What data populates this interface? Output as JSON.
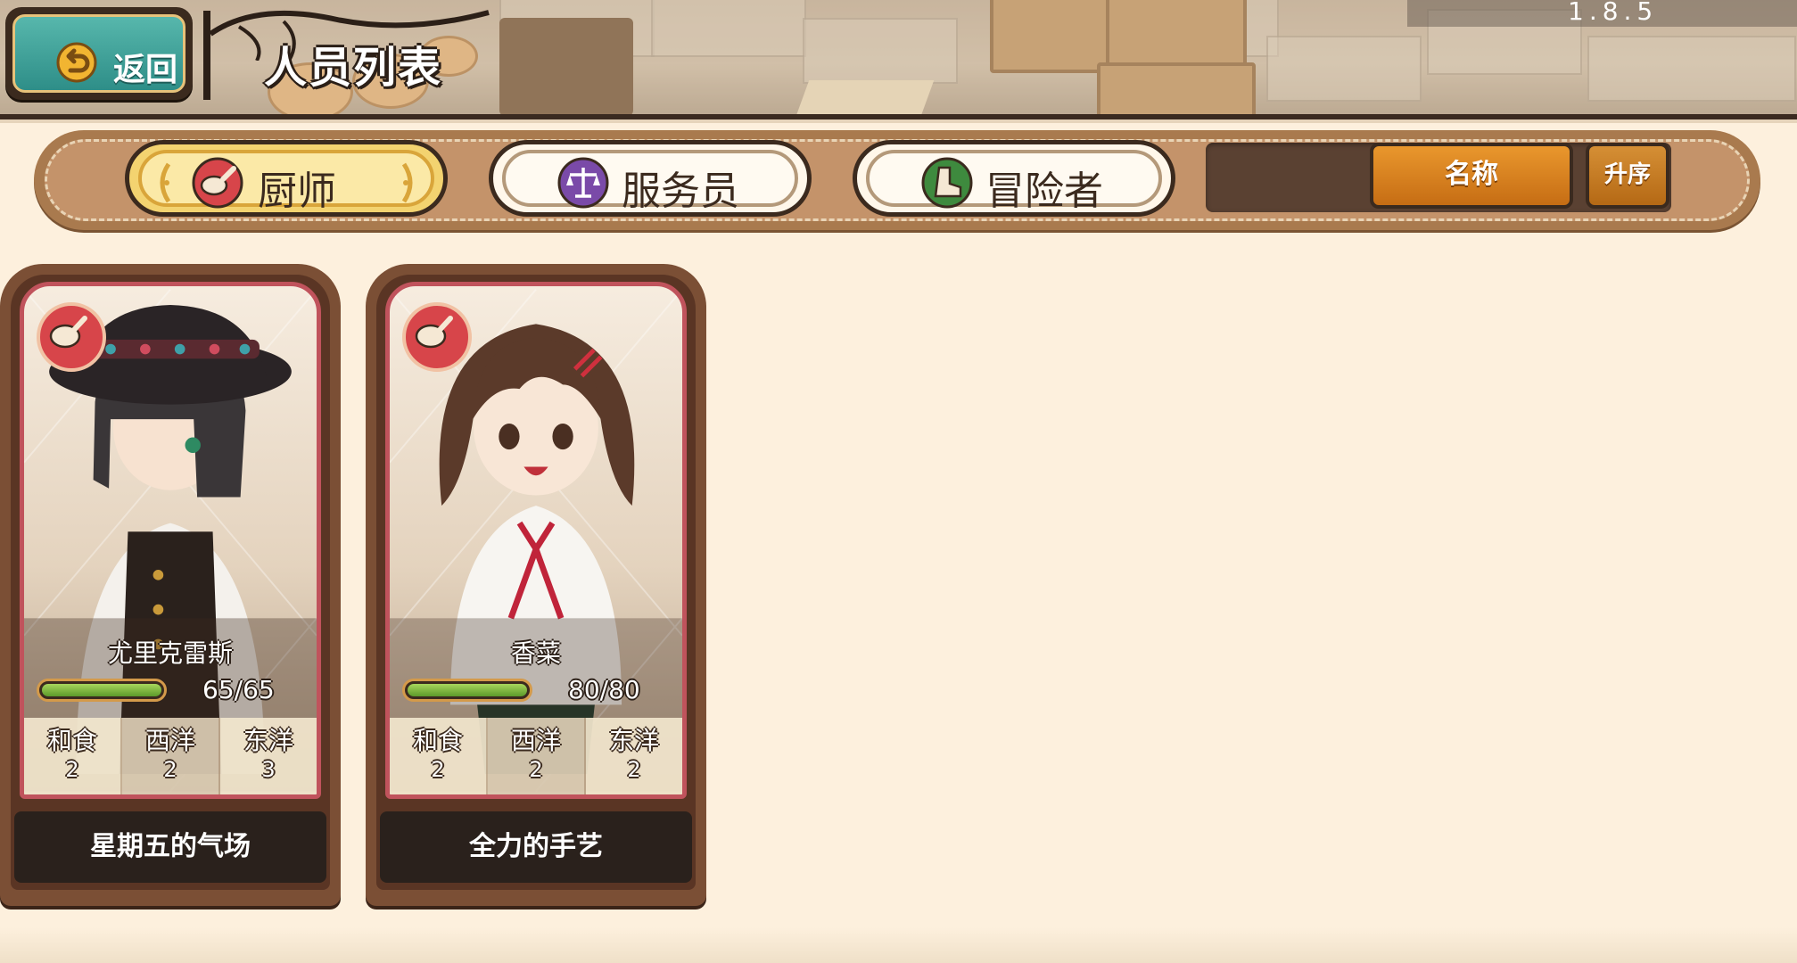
{
  "version": "1.8.5",
  "header": {
    "back_label": "返回",
    "title": "人员列表"
  },
  "tabs": [
    {
      "label": "厨师",
      "icon": "frying-pan-icon",
      "selected": true
    },
    {
      "label": "服务员",
      "icon": "scales-icon",
      "selected": false
    },
    {
      "label": "冒险者",
      "icon": "boot-icon",
      "selected": false
    }
  ],
  "sort": {
    "field_label": "名称",
    "order_label": "升序"
  },
  "stat_labels": [
    "和食",
    "西洋",
    "东洋"
  ],
  "cards": [
    {
      "name": "尤里克雷斯",
      "hp_text": "65/65",
      "hp_fraction": 1.0,
      "stats": [
        "2",
        "2",
        "3"
      ],
      "skill": "星期五的气场"
    },
    {
      "name": "香菜",
      "hp_text": "80/80",
      "hp_fraction": 1.0,
      "stats": [
        "2",
        "2",
        "2"
      ],
      "skill": "全力的手艺"
    }
  ],
  "colors": {
    "page_bg": "#fdf0dd",
    "selected_tab": "#f3d370",
    "sort_button": "#e9972d",
    "card_border": "#c0535c",
    "hp_fill": "#7cbf3a",
    "chef_badge": "#d7454a",
    "waiter_badge": "#7a4aa8",
    "adventurer_badge": "#3e8a3e"
  }
}
